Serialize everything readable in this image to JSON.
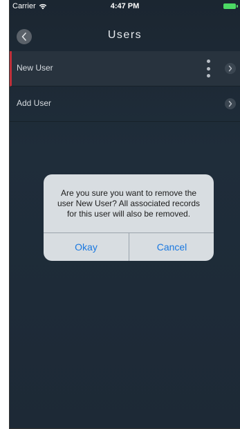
{
  "status_bar": {
    "carrier": "Carrier",
    "time": "4:47 PM",
    "battery_color": "#4cd964"
  },
  "nav": {
    "title": "Users",
    "back_icon": "chevron-left-icon"
  },
  "list": {
    "items": [
      {
        "label": "New User",
        "selected": true
      },
      {
        "label": "Add User",
        "selected": false
      }
    ],
    "accent_color": "#c0303a"
  },
  "alert": {
    "message": "Are you sure you want to remove the user New User? All associated records for this user will also be removed.",
    "okay_label": "Okay",
    "cancel_label": "Cancel",
    "button_color": "#1a78e0"
  }
}
